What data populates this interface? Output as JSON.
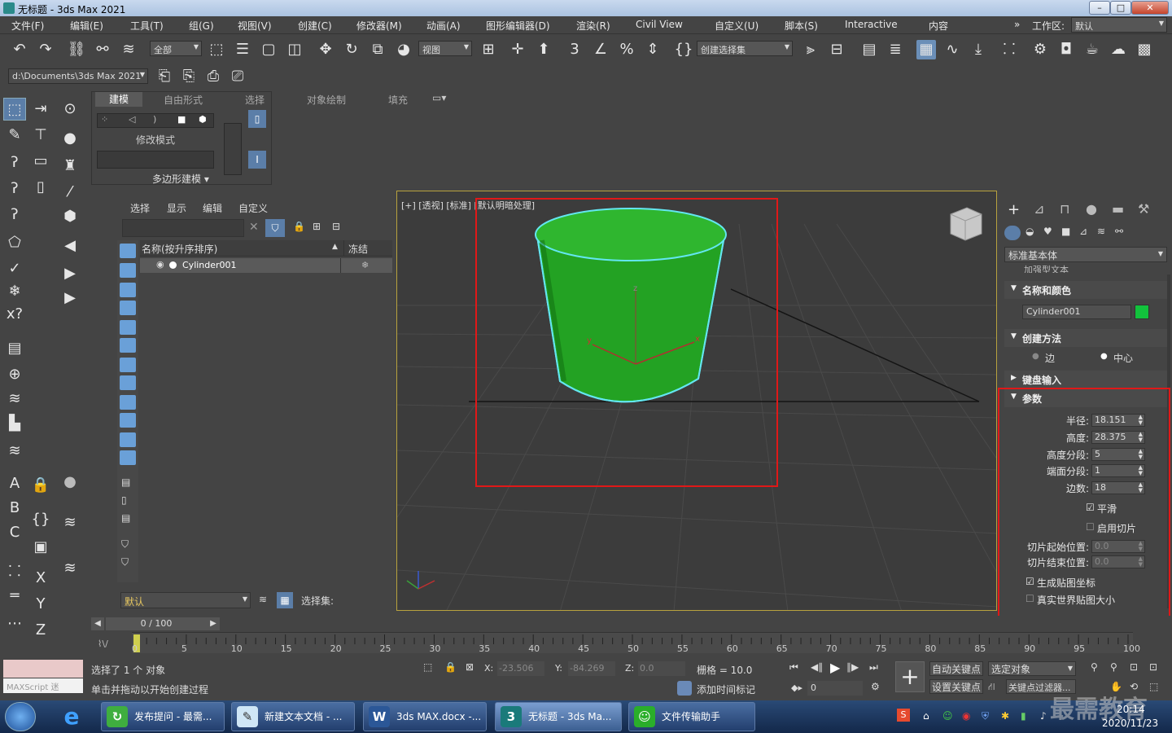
{
  "title": "无标题 - 3ds Max 2021",
  "window_buttons": [
    "–",
    "□",
    "✕"
  ],
  "menu": [
    "文件(F)",
    "编辑(E)",
    "工具(T)",
    "组(G)",
    "视图(V)",
    "创建(C)",
    "修改器(M)",
    "动画(A)",
    "图形编辑器(D)",
    "渲染(R)",
    "Civil View",
    "自定义(U)",
    "脚本(S)",
    "Interactive",
    "内容"
  ],
  "workspace": {
    "label": "工作区:",
    "value": "默认",
    "chev": "»"
  },
  "toolbar": {
    "filter": "全部",
    "ref_coord": "视图",
    "selset": "创建选择集"
  },
  "path": "d:\\Documents\\3ds Max 2021",
  "ribbon": {
    "tabs": [
      "建模",
      "自由形式",
      "选择",
      "对象绘制",
      "填充"
    ],
    "mode_label": "修改模式",
    "poly_label": "多边形建模 ▾"
  },
  "scene": {
    "tabs": [
      "选择",
      "显示",
      "编辑",
      "自定义"
    ],
    "col_name": "名称(按升序排序)",
    "col_freeze": "冻结",
    "sort_arrow": "▲",
    "items": [
      {
        "name": "Cylinder001",
        "freeze_icon": "❄"
      }
    ],
    "layer": "默认",
    "selset_label": "选择集:"
  },
  "viewport": {
    "label": "[+] [透视] [标准] [默认明暗处理]",
    "axis_x": "x",
    "axis_y": "y",
    "axis_z": "z",
    "object_color": "#22a822",
    "selection_color": "#63e6f0"
  },
  "cmd": {
    "category": "标准基本体",
    "partial_text": "加强型文本",
    "name_color": {
      "title": "名称和颜色",
      "name": "Cylinder001",
      "color": "#12c23c"
    },
    "creation": {
      "title": "创建方法",
      "edge": "边",
      "center": "中心"
    },
    "keyboard": {
      "title": "键盘输入"
    },
    "params": {
      "title": "参数",
      "radius": {
        "label": "半径:",
        "value": "18.151"
      },
      "height": {
        "label": "高度:",
        "value": "28.375"
      },
      "height_segs": {
        "label": "高度分段:",
        "value": "5"
      },
      "cap_segs": {
        "label": "端面分段:",
        "value": "1"
      },
      "sides": {
        "label": "边数:",
        "value": "18"
      },
      "smooth": "平滑",
      "slice_on": "启用切片",
      "slice_from": {
        "label": "切片起始位置:",
        "value": "0.0"
      },
      "slice_to": {
        "label": "切片结束位置:",
        "value": "0.0"
      },
      "gen_uv": "生成贴图坐标",
      "real_world": "真实世界贴图大小"
    }
  },
  "timeline": {
    "frame": "0 / 100",
    "ticks": [
      "0",
      "5",
      "10",
      "15",
      "20",
      "25",
      "30",
      "35",
      "40",
      "45",
      "50",
      "55",
      "60",
      "65",
      "70",
      "75",
      "80",
      "85",
      "90",
      "95",
      "100"
    ]
  },
  "status": {
    "maxscript": "MAXScript 迷",
    "selected": "选择了 1 个 对象",
    "hint": "单击并拖动以开始创建过程",
    "x_label": "X:",
    "x": "-23.506",
    "y_label": "Y:",
    "y": "-84.269",
    "z_label": "Z:",
    "z": "0.0",
    "grid": "栅格 = 10.0",
    "add_time_tag": "添加时间标记",
    "auto_key": "自动关键点",
    "set_key": "设置关键点",
    "selected_obj": "选定对象",
    "key_filters": "关键点过滤器...",
    "frame_field": "0"
  },
  "taskbar": {
    "tasks": [
      "发布提问 - 最需...",
      "新建文本文档 - ...",
      "3ds MAX.docx -...",
      "无标题 - 3ds Ma...",
      "文件传输助手"
    ],
    "time": "20:14",
    "date": "2020/11/23",
    "watermark": "最需教育"
  }
}
